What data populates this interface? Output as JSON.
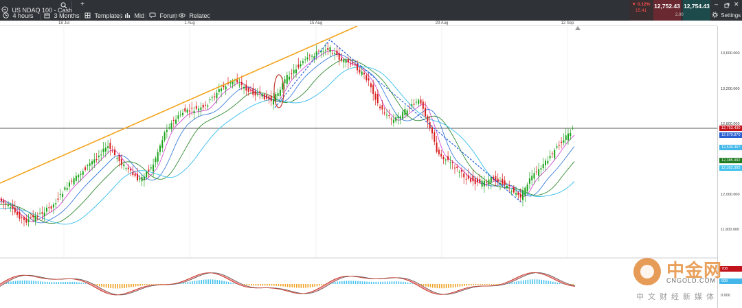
{
  "toolbar": {
    "instrument": "US NDAQ 100 - Cash",
    "timeframe": "4 hours",
    "range": "3 Months",
    "templates": "Templates",
    "mid": "Mid",
    "forum": "Forum",
    "related": "Related",
    "settings": "Settings",
    "change_pct": "▼ 0.12%",
    "change_abs": "15.41",
    "bid": "12,752.43",
    "ask": "12,754.43",
    "spread": "2.00"
  },
  "date_axis": [
    "18 Jul",
    "1 Aug",
    "15 Aug",
    "29 Aug",
    "12 Sep"
  ],
  "price_axis": {
    "ticks": [
      "13,600.000",
      "13,200.000",
      "12,800.000",
      "12,000.000",
      "11,600.000"
    ],
    "tags": [
      {
        "value": "12,753.430",
        "color": "#c2121b"
      },
      {
        "value": "12,679.870",
        "color": "#2a5fd0"
      },
      {
        "value": "12,530.357",
        "color": "#43b7e9"
      },
      {
        "value": "12,385.992",
        "color": "#1f7a1f"
      },
      {
        "value": "12,352.392",
        "color": "#46c3ec"
      }
    ],
    "osc_tags": [
      {
        "value": "708",
        "color": "#c2121b"
      },
      {
        "value": "699",
        "color": "#43b7e9"
      }
    ],
    "osc_tick": "0.000"
  },
  "watermark": {
    "cn": "中金网",
    "domain": "CNGOLD.COM",
    "sub": "中文财经新媒体"
  },
  "colors": {
    "up": "#1aa31a",
    "down": "#d81c1c",
    "trendline": "#f4a31c",
    "dashed": "#2a63d8",
    "ma_fast": "#d14ad3",
    "ma_mid": "#2f8a2f",
    "ma_slow": "#47c2ee",
    "osc_fill": "#f08080",
    "osc_gray": "#888888"
  }
}
